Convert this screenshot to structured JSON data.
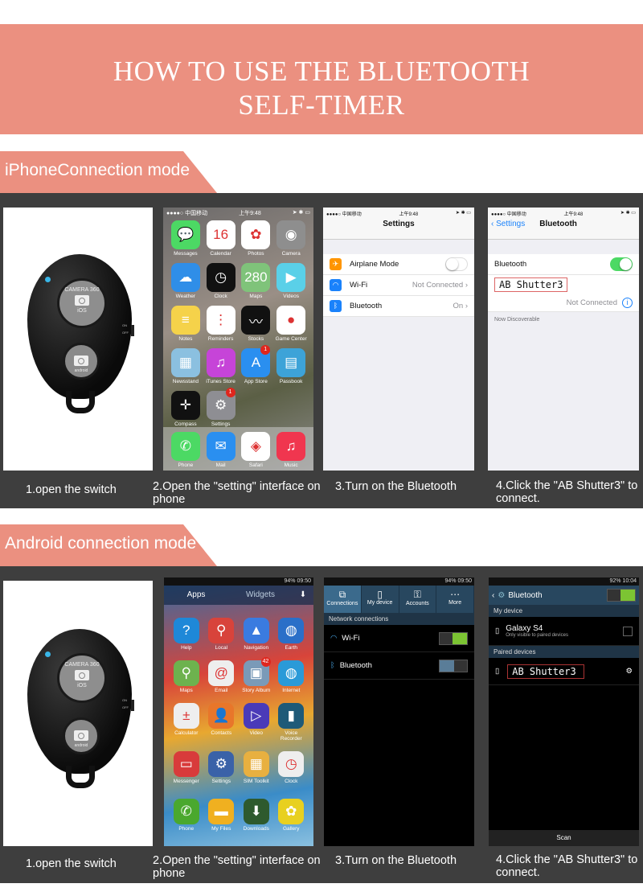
{
  "title": {
    "line1": "HOW TO USE THE BLUETOOTH",
    "line2": "SELF-TIMER"
  },
  "colors": {
    "accent": "#eb9080",
    "panel": "#3e3e3e",
    "ios_green": "#4cd964",
    "android_green": "#7cc433",
    "highlight_box": "#d66666"
  },
  "remote": {
    "button_top_label": "CAMERA 360",
    "button_top_sub": "iOS",
    "button_bottom_label": "android",
    "switch_on": "ON",
    "switch_off": "OFF"
  },
  "iphone": {
    "tab": "iPhoneConnection mode",
    "status": {
      "carrier": "●●●●○ 中国移动",
      "time": "上午9:48",
      "icons": "➤ ✱ ▭"
    },
    "home_apps": [
      {
        "label": "Messages",
        "icon": "message-icon",
        "color": "#4cd964",
        "glyph": "💬"
      },
      {
        "label": "Calendar",
        "icon": "calendar-icon",
        "color": "#ffffff",
        "glyph": "16"
      },
      {
        "label": "Photos",
        "icon": "photos-icon",
        "color": "#ffffff",
        "glyph": "✿"
      },
      {
        "label": "Camera",
        "icon": "camera-icon",
        "color": "#8e8e8e",
        "glyph": "◉"
      },
      {
        "label": "Weather",
        "icon": "weather-icon",
        "color": "#2f8ee8",
        "glyph": "☁"
      },
      {
        "label": "Clock",
        "icon": "clock-icon",
        "color": "#111111",
        "glyph": "◷"
      },
      {
        "label": "Maps",
        "icon": "maps-icon",
        "color": "#7fc37a",
        "glyph": "280"
      },
      {
        "label": "Videos",
        "icon": "videos-icon",
        "color": "#5ad0e8",
        "glyph": "▶"
      },
      {
        "label": "Notes",
        "icon": "notes-icon",
        "color": "#f5d24a",
        "glyph": "≡"
      },
      {
        "label": "Reminders",
        "icon": "reminders-icon",
        "color": "#ffffff",
        "glyph": "⋮"
      },
      {
        "label": "Stocks",
        "icon": "stocks-icon",
        "color": "#111111",
        "glyph": "〰"
      },
      {
        "label": "Game Center",
        "icon": "game-center-icon",
        "color": "#ffffff",
        "glyph": "●"
      },
      {
        "label": "Newsstand",
        "icon": "newsstand-icon",
        "color": "#8bc0e0",
        "glyph": "▦"
      },
      {
        "label": "iTunes Store",
        "icon": "itunes-icon",
        "color": "#c644d8",
        "glyph": "♫"
      },
      {
        "label": "App Store",
        "icon": "app-store-icon",
        "color": "#2a8ff0",
        "glyph": "A",
        "badge": "1"
      },
      {
        "label": "Passbook",
        "icon": "passbook-icon",
        "color": "#3da3d8",
        "glyph": "▤"
      },
      {
        "label": "Compass",
        "icon": "compass-icon",
        "color": "#111111",
        "glyph": "✛"
      },
      {
        "label": "Settings",
        "icon": "settings-icon",
        "color": "#8e8e93",
        "glyph": "⚙",
        "badge": "1"
      }
    ],
    "dock_apps": [
      {
        "label": "Phone",
        "icon": "phone-icon",
        "color": "#4cd964",
        "glyph": "✆"
      },
      {
        "label": "Mail",
        "icon": "mail-icon",
        "color": "#2a8ff0",
        "glyph": "✉"
      },
      {
        "label": "Safari",
        "icon": "safari-icon",
        "color": "#ffffff",
        "glyph": "◈"
      },
      {
        "label": "Music",
        "icon": "music-icon",
        "color": "#f0364f",
        "glyph": "♫"
      }
    ],
    "settings": {
      "title": "Settings",
      "rows": [
        {
          "label": "Airplane Mode",
          "value": "",
          "icon": "airplane-icon",
          "color": "#ff9500",
          "glyph": "✈"
        },
        {
          "label": "Wi-Fi",
          "value": "Not Connected  ›",
          "icon": "wifi-icon",
          "color": "#1a82fb",
          "glyph": "◠"
        },
        {
          "label": "Bluetooth",
          "value": "On  ›",
          "icon": "bluetooth-icon",
          "color": "#1a82fb",
          "glyph": "ᛒ"
        }
      ]
    },
    "bluetooth": {
      "back": "‹ Settings",
      "title": "Bluetooth",
      "toggle_label": "Bluetooth",
      "device": "AB Shutter3",
      "device_status": "Not Connected",
      "info": "i",
      "discoverable": "Now Discoverable"
    },
    "steps": [
      "1.open the switch",
      "2.Open the \"setting\" interface on phone",
      "3.Turn on the Bluetooth",
      "4.Click the \"AB Shutter3\" to connect."
    ]
  },
  "android": {
    "tab": "Android connection mode",
    "status1": "94% 09:50",
    "status2": "92% 10:04",
    "drawer_tabs": [
      "Apps",
      "Widgets"
    ],
    "apps": [
      {
        "label": "Help",
        "icon": "help-icon",
        "color": "#1e88d8",
        "glyph": "?"
      },
      {
        "label": "Local",
        "icon": "local-icon",
        "color": "#d8433b",
        "glyph": "⚲"
      },
      {
        "label": "Navigation",
        "icon": "navigation-icon",
        "color": "#3a7be0",
        "glyph": "▲"
      },
      {
        "label": "Earth",
        "icon": "earth-icon",
        "color": "#2a6fc8",
        "glyph": "◍"
      },
      {
        "label": "Maps",
        "icon": "maps-icon",
        "color": "#6db24e",
        "glyph": "⚲"
      },
      {
        "label": "Email",
        "icon": "email-icon",
        "color": "#eeeeee",
        "glyph": "@"
      },
      {
        "label": "Story Album",
        "icon": "story-album-icon",
        "color": "#7a9ab8",
        "glyph": "▣",
        "badge": "42"
      },
      {
        "label": "Internet",
        "icon": "internet-icon",
        "color": "#2a9ad8",
        "glyph": "◍"
      },
      {
        "label": "Calculator",
        "icon": "calculator-icon",
        "color": "#eeeeee",
        "glyph": "±"
      },
      {
        "label": "Contacts",
        "icon": "contacts-icon",
        "color": "#e8762a",
        "glyph": "👤"
      },
      {
        "label": "Video",
        "icon": "video-icon",
        "color": "#4a3ab8",
        "glyph": "▷"
      },
      {
        "label": "Voice Recorder",
        "icon": "voice-recorder-icon",
        "color": "#1e5a78",
        "glyph": "▮"
      },
      {
        "label": "Messenger",
        "icon": "messenger-icon",
        "color": "#d83b3b",
        "glyph": "▭"
      },
      {
        "label": "Settings",
        "icon": "settings-icon",
        "color": "#3a62a8",
        "glyph": "⚙"
      },
      {
        "label": "SIM Toolkit",
        "icon": "sim-toolkit-icon",
        "color": "#e8b040",
        "glyph": "▦"
      },
      {
        "label": "Clock",
        "icon": "clock-icon",
        "color": "#eeeeee",
        "glyph": "◷"
      }
    ],
    "dock": [
      {
        "label": "Phone",
        "icon": "phone-icon",
        "color": "#4aa82e",
        "glyph": "✆"
      },
      {
        "label": "My Files",
        "icon": "folder-icon",
        "color": "#f0b020",
        "glyph": "▬"
      },
      {
        "label": "Downloads",
        "icon": "downloads-icon",
        "color": "#2e5a2e",
        "glyph": "⬇"
      },
      {
        "label": "Gallery",
        "icon": "gallery-icon",
        "color": "#e8d020",
        "glyph": "✿"
      }
    ],
    "settings": {
      "tabs": [
        {
          "label": "Connections",
          "glyph": "⧉"
        },
        {
          "label": "My device",
          "glyph": "▯"
        },
        {
          "label": "Accounts",
          "glyph": "⚿"
        },
        {
          "label": "More",
          "glyph": "⋯"
        }
      ],
      "section": "Network connections",
      "rows": [
        {
          "label": "Wi-Fi",
          "on": true,
          "icon": "wifi-icon"
        },
        {
          "label": "Bluetooth",
          "on": false,
          "icon": "bluetooth-icon"
        }
      ]
    },
    "bluetooth": {
      "title": "Bluetooth",
      "my_device": "My device",
      "device_name": "Galaxy S4",
      "device_sub": "Only visible to paired devices",
      "paired": "Paired devices",
      "paired_device": "AB Shutter3",
      "scan": "Scan"
    },
    "steps": [
      "1.open the switch",
      "2.Open the \"setting\" interface on phone",
      "3.Turn on the Bluetooth",
      "4.Click the \"AB Shutter3\" to connect."
    ]
  }
}
